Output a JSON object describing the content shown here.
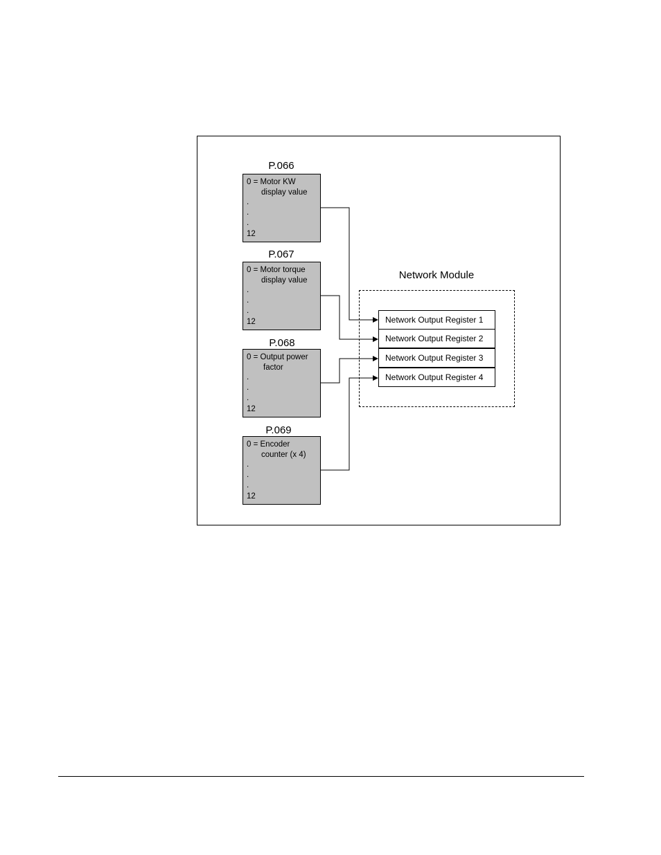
{
  "diagram": {
    "parameters": [
      {
        "id": "P.066",
        "line1": "0 = Motor KW",
        "line2": "display value",
        "dots": [
          ".",
          ".",
          "."
        ],
        "max": "12",
        "target_register": 1
      },
      {
        "id": "P.067",
        "line1": "0 = Motor torque",
        "line2": "display value",
        "dots": [
          ".",
          ".",
          "."
        ],
        "max": "12",
        "target_register": 2
      },
      {
        "id": "P.068",
        "line1": "0 = Output power",
        "line2": "factor",
        "dots": [
          ".",
          ".",
          "."
        ],
        "max": "12",
        "target_register": 3
      },
      {
        "id": "P.069",
        "line1": "0 = Encoder",
        "line2": "counter (x 4)",
        "dots": [
          ".",
          ".",
          "."
        ],
        "max": "12",
        "target_register": 4
      }
    ],
    "network_module": {
      "title": "Network Module",
      "registers": [
        "Network Output Register 1",
        "Network Output Register 2",
        "Network Output Register 3",
        "Network Output Register 4"
      ]
    },
    "colors": {
      "param_box_fill": "#c0c0c0",
      "line": "#000000"
    }
  }
}
